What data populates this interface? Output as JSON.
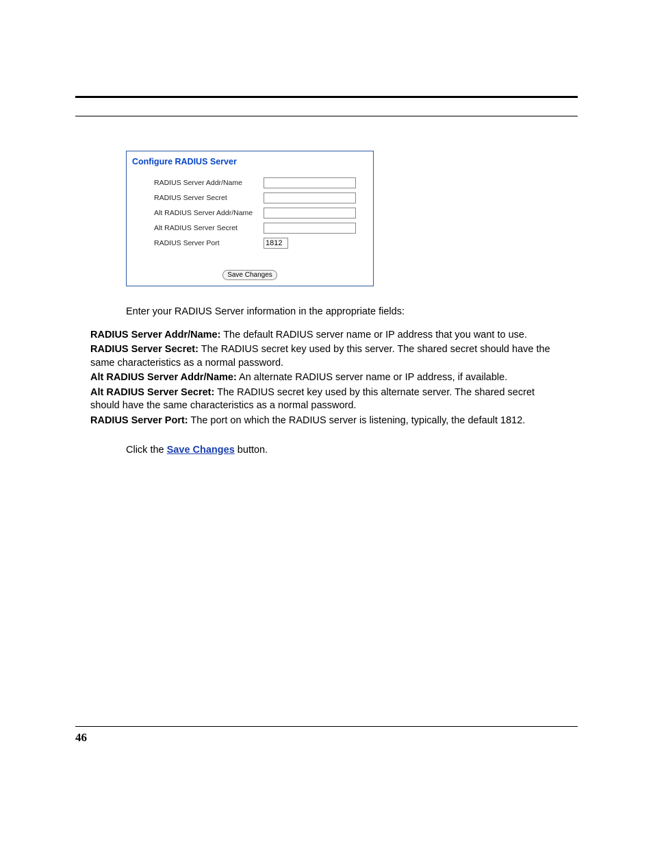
{
  "panel": {
    "title": "Configure RADIUS Server",
    "fields": [
      {
        "label": "RADIUS Server Addr/Name",
        "value": "",
        "wide": true
      },
      {
        "label": "RADIUS Server Secret",
        "value": "",
        "wide": true
      },
      {
        "label": "Alt RADIUS Server Addr/Name",
        "value": "",
        "wide": true
      },
      {
        "label": "Alt RADIUS Server Secret",
        "value": "",
        "wide": true
      },
      {
        "label": "RADIUS Server Port",
        "value": "1812",
        "wide": false
      }
    ],
    "save_label": "Save Changes"
  },
  "intro": "Enter your RADIUS Server information in the appropriate fields:",
  "definitions": [
    {
      "term": "RADIUS Server Addr/Name:",
      "desc": " The default RADIUS server name or IP address that you want to use."
    },
    {
      "term": "RADIUS Server Secret:",
      "desc": " The RADIUS secret key used by this server. The shared secret should have the same characteristics as a normal password."
    },
    {
      "term": "Alt RADIUS Server Addr/Name:",
      "desc": " An alternate RADIUS server name or IP address, if available."
    },
    {
      "term": "Alt RADIUS Server Secret:",
      "desc": " The RADIUS secret key used by this alternate server. The shared secret should have the same characteristics as a normal password."
    },
    {
      "term": "RADIUS Server Port:",
      "desc": " The port on which the RADIUS server is listening, typically, the default 1812."
    }
  ],
  "closing_prefix": "Click the ",
  "closing_link": "Save Changes",
  "closing_suffix": " button.",
  "page_number": "46"
}
